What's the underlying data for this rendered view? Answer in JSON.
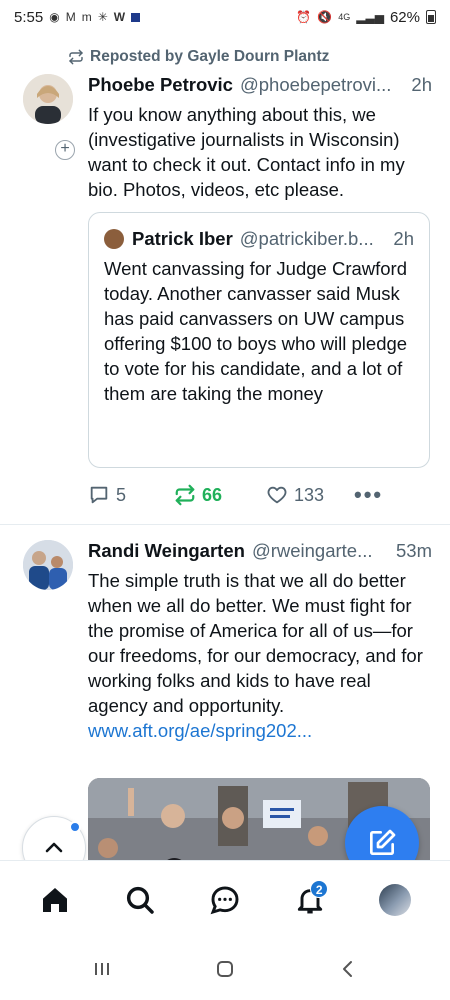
{
  "status_bar": {
    "time": "5:55",
    "battery": "62%",
    "left_icons": [
      "signal-app-icon",
      "gmail-icon",
      "gmail-icon",
      "walmart-icon",
      "w-icon",
      "square-icon"
    ],
    "right_icons": [
      "alarm-icon",
      "mute-icon",
      "network-4g-icon",
      "signal-icon",
      "battery-icon"
    ]
  },
  "feed": {
    "posts": [
      {
        "repost_label": "Reposted by Gayle Dourn Plantz",
        "author_name": "Phoebe Petrovic",
        "author_handle": "@phoebepetrovi...",
        "time": "2h",
        "text": "If you know anything about this, we (investigative journalists in Wisconsin) want to check it out.  Contact info in my bio. Photos, videos, etc please.",
        "quote": {
          "author_name": "Patrick Iber",
          "author_handle": "@patrickiber.b...",
          "time": "2h",
          "text": "Went canvassing for Judge Crawford today. Another canvasser said Musk has paid canvassers on UW campus offering $100 to boys who will pledge to vote for his candidate, and a lot of them are taking the money"
        },
        "replies": "5",
        "reposts": "66",
        "likes": "133"
      },
      {
        "author_name": "Randi Weingarten",
        "author_handle": "@rweingarte...",
        "time": "53m",
        "text": "The simple truth is that we all do better when we all do better. We must fight for the promise of America for all of us—for our freedoms, for our democracy, and for working folks and kids to have real agency and opportunity. ",
        "link_text": "www.aft.org/ae/spring202..."
      }
    ]
  },
  "tabbar": {
    "notifications_badge": "2",
    "tabs": [
      "home-icon",
      "search-icon",
      "chat-icon",
      "bell-icon",
      "profile-avatar"
    ]
  },
  "colors": {
    "accent": "#2e7ef0",
    "repost_green": "#20b05a",
    "link": "#1d76d2",
    "muted": "#536471"
  }
}
